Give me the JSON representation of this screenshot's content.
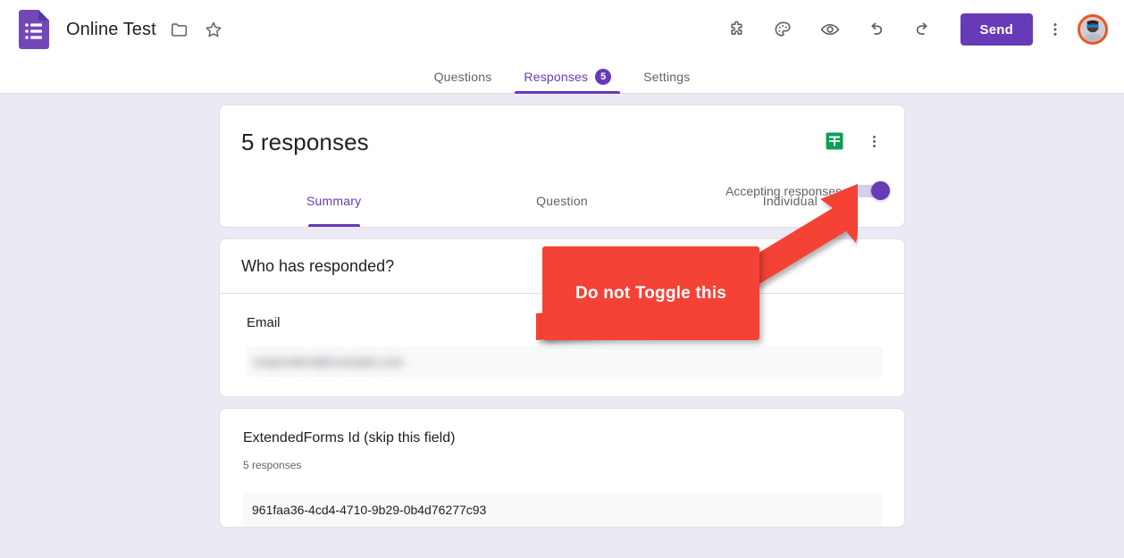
{
  "header": {
    "app_icon": "google-forms-icon",
    "doc_title": "Online Test",
    "folder_icon": "folder-icon",
    "star_icon": "star-icon",
    "actions": [
      {
        "icon": "addons-puzzle-icon",
        "label": "Add-ons"
      },
      {
        "icon": "palette-theme-icon",
        "label": "Customize theme"
      },
      {
        "icon": "eye-preview-icon",
        "label": "Preview"
      },
      {
        "icon": "undo-icon",
        "label": "Undo"
      },
      {
        "icon": "redo-icon",
        "label": "Redo"
      }
    ],
    "send_label": "Send",
    "more_icon": "more-vert-icon",
    "avatar_icon": "account-avatar",
    "send_color": "#673ab7",
    "avatar_ring_color": "#f4511e"
  },
  "tabs": [
    {
      "label": "Questions",
      "active": false,
      "badge": ""
    },
    {
      "label": "Responses",
      "active": true,
      "badge": "5"
    },
    {
      "label": "Settings",
      "active": false,
      "badge": ""
    }
  ],
  "responses_card": {
    "count_title": "5 responses",
    "sheets_icon": "google-sheets-icon",
    "more_icon": "more-vert-icon",
    "accepting_label": "Accepting responses",
    "accepting_state": "on",
    "accent_color": "#673ab7",
    "sub_tabs": [
      {
        "label": "Summary",
        "active": true
      },
      {
        "label": "Question",
        "active": false
      },
      {
        "label": "Individual",
        "active": false
      }
    ]
  },
  "who_card": {
    "title": "Who has responded?",
    "field_label": "Email",
    "field_value": "respondent@example.com",
    "value_redacted": true
  },
  "extended_forms_card": {
    "question_title": "ExtendedForms Id (skip this field)",
    "response_count": "5 responses",
    "first_value": "961faa36-4cd4-4710-9b29-0b4d76277c93"
  },
  "annotation": {
    "text": "Do not Toggle this",
    "color": "#f44336",
    "arrow_icon": "red-arrow-pointing-up-right"
  }
}
